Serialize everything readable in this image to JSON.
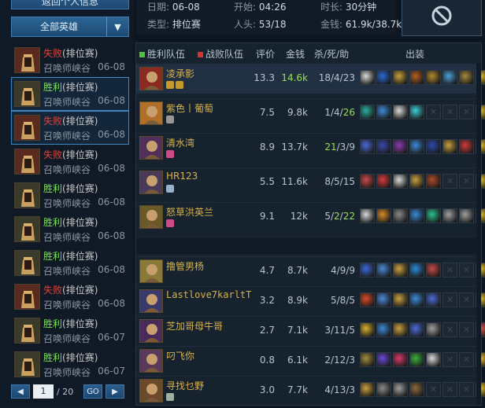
{
  "nav": {
    "back_label": "返回个人信息",
    "hero_filter": "全部英雄"
  },
  "match_info": {
    "date_label": "日期:",
    "date": "06-08",
    "start_label": "开始:",
    "start": "04:26",
    "duration_label": "时长:",
    "duration": "30分钟",
    "type_label": "类型:",
    "type": "排位赛",
    "players_label": "人头:",
    "players": "53/18",
    "gold_label": "金钱:",
    "gold": "61.9k/38.7k"
  },
  "matches": [
    {
      "result": "失败",
      "outcome": "lose",
      "queue": "(排位赛)",
      "map": "召唤师峡谷",
      "date": "06-08",
      "selected": false
    },
    {
      "result": "胜利",
      "outcome": "win",
      "queue": "(排位赛)",
      "map": "召唤师峡谷",
      "date": "06-08",
      "selected": true
    },
    {
      "result": "失败",
      "outcome": "lose",
      "queue": "(排位赛)",
      "map": "召唤师峡谷",
      "date": "06-08",
      "selected": true
    },
    {
      "result": "失败",
      "outcome": "lose",
      "queue": "(排位赛)",
      "map": "召唤师峡谷",
      "date": "06-08",
      "selected": false
    },
    {
      "result": "胜利",
      "outcome": "win",
      "queue": "(排位赛)",
      "map": "召唤师峡谷",
      "date": "06-08",
      "selected": false
    },
    {
      "result": "胜利",
      "outcome": "win",
      "queue": "(排位赛)",
      "map": "召唤师峡谷",
      "date": "06-08",
      "selected": false
    },
    {
      "result": "胜利",
      "outcome": "win",
      "queue": "(排位赛)",
      "map": "召唤师峡谷",
      "date": "06-08",
      "selected": false
    },
    {
      "result": "失败",
      "outcome": "lose",
      "queue": "(排位赛)",
      "map": "召唤师峡谷",
      "date": "06-08",
      "selected": false
    },
    {
      "result": "胜利",
      "outcome": "win",
      "queue": "(排位赛)",
      "map": "召唤师峡谷",
      "date": "06-07",
      "selected": false
    },
    {
      "result": "胜利",
      "outcome": "win",
      "queue": "(排位赛)",
      "map": "召唤师峡谷",
      "date": "06-07",
      "selected": false
    }
  ],
  "pager": {
    "current": "1",
    "total": "/ 20",
    "go_label": "GO"
  },
  "scoreboard": {
    "headers": {
      "win_team": "胜利队伍",
      "lose_team": "战败队伍",
      "rating": "评价",
      "gold": "金钱",
      "kda": "杀/死/助",
      "items": "出装"
    },
    "win_color": "#4ec43a",
    "lose_color": "#d0362c",
    "winners": [
      {
        "name": "凌承影",
        "rating": "13.3",
        "gold": "14.6k",
        "kda": [
          "18",
          "4",
          "23"
        ],
        "hl": [],
        "champ_color": "#8a2a20",
        "badges": [
          "#c89a2a",
          "#c89a2a"
        ],
        "items": [
          "#d8d8d8",
          "#2a6ad8",
          "#c8a040",
          "#b06020",
          "#b08a30",
          "#4aa0d8",
          "#a08a40",
          "#d8b020"
        ]
      },
      {
        "name": "紫色丨葡萄",
        "rating": "7.5",
        "gold": "9.8k",
        "kda": [
          "1",
          "4",
          "26"
        ],
        "hl": [
          2
        ],
        "champ_color": "#b0702a",
        "badges": [
          "#9a9a9a"
        ],
        "items": [
          "#2ab0a0",
          "#3a8ad8",
          "#d8d8d8",
          "#3ad0d8",
          "",
          "",
          "",
          "#d8b020"
        ]
      },
      {
        "name": "清水湾",
        "rating": "8.9",
        "gold": "13.7k",
        "kda": [
          "21",
          "3",
          "9"
        ],
        "hl": [
          0
        ],
        "champ_color": "#50305a",
        "badges": [
          "#d04a8a"
        ],
        "items": [
          "#4a6ad8",
          "#3a4ab0",
          "#8a3ab0",
          "#3a8ad8",
          "#2a4ab0",
          "#c8a040",
          "#d03a3a",
          "#d8b020"
        ]
      },
      {
        "name": "HR123",
        "rating": "5.5",
        "gold": "11.6k",
        "kda": [
          "8",
          "5",
          "15"
        ],
        "hl": [],
        "champ_color": "#4a3a5a",
        "badges": [
          "#9ab0c8"
        ],
        "items": [
          "#c84a4a",
          "#d83a3a",
          "#d8d8d8",
          "#c8a040",
          "#b04a2a",
          "",
          "",
          "#d8b020"
        ]
      },
      {
        "name": "怒草洪英兰",
        "rating": "9.1",
        "gold": "12k",
        "kda": [
          "5",
          "2",
          "22"
        ],
        "hl": [
          1,
          2
        ],
        "champ_color": "#6a5a2a",
        "badges": [
          "#d04a8a"
        ],
        "items": [
          "#d8d8d8",
          "#d88a2a",
          "#8a8a8a",
          "#3a8ad8",
          "#2ac08a",
          "#a0a0a0",
          "#a0a0a0",
          "#d8b020"
        ]
      }
    ],
    "losers": [
      {
        "name": "撸管男杨",
        "rating": "4.7",
        "gold": "8.7k",
        "kda": [
          "4",
          "9",
          "9"
        ],
        "hl": [],
        "champ_color": "#8a7a3a",
        "badges": [],
        "items": [
          "#3a6ad8",
          "#4a8ad8",
          "#c8a040",
          "#2a8ad8",
          "#c84a4a",
          "",
          "",
          "#d8b020"
        ]
      },
      {
        "name": "Lastlove7karltT",
        "rating": "3.2",
        "gold": "8.9k",
        "kda": [
          "5",
          "8",
          "5"
        ],
        "hl": [],
        "mono": true,
        "champ_color": "#3a3a6a",
        "badges": [],
        "items": [
          "#d84a2a",
          "#4a8ad8",
          "#c8a040",
          "#3a8ad8",
          "#4a6ad8",
          "",
          "",
          "#d8b020"
        ]
      },
      {
        "name": "芝加哥母牛哥",
        "rating": "2.7",
        "gold": "7.1k",
        "kda": [
          "3",
          "11",
          "5"
        ],
        "hl": [],
        "champ_color": "#4a2a5a",
        "badges": [],
        "items": [
          "#d8b030",
          "#3a8ad8",
          "#c8a040",
          "#4a6ad8",
          "#a0a0a0",
          "",
          "",
          "#d84a4a"
        ]
      },
      {
        "name": "叼飞你",
        "rating": "0.8",
        "gold": "6.1k",
        "kda": [
          "2",
          "12",
          "3"
        ],
        "hl": [],
        "champ_color": "#5a3a5a",
        "badges": [],
        "items": [
          "#a08a40",
          "#6a4ad8",
          "#d83a6a",
          "#3ab03a",
          "#d8d8d8",
          "",
          "",
          "#d8b020"
        ]
      },
      {
        "name": "寻找乜野",
        "rating": "3.0",
        "gold": "7.7k",
        "kda": [
          "4",
          "13",
          "3"
        ],
        "hl": [],
        "champ_color": "#6a4a2a",
        "badges": [
          "#9ab0a0"
        ],
        "items": [
          "#c8a040",
          "#8a8a8a",
          "#a0a0a0",
          "#8a6a3a",
          "",
          "",
          "",
          "#d8b020"
        ]
      }
    ]
  }
}
